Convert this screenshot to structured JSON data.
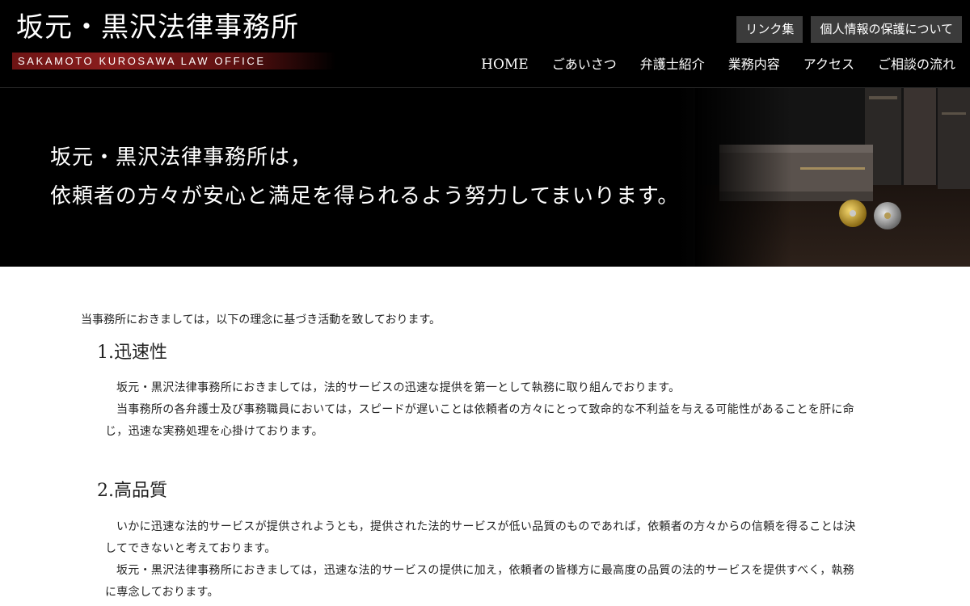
{
  "header": {
    "logo_title": "坂元・黒沢法律事務所",
    "logo_subtitle": "SAKAMOTO KUROSAWA LAW OFFICE",
    "utility_links": [
      "リンク集",
      "個人情報の保護について"
    ],
    "nav": [
      "HOME",
      "ごあいさつ",
      "弁護士紹介",
      "業務内容",
      "アクセス",
      "ご相談の流れ"
    ]
  },
  "hero": {
    "line1": "坂元・黒沢法律事務所は，",
    "line2": "依頼者の方々が安心と満足を得られるよう努力してまいります。"
  },
  "content": {
    "intro": "当事務所におきましては，以下の理念に基づき活動を致しております。",
    "sections": [
      {
        "title": "1.迅速性",
        "paragraphs": [
          "坂元・黒沢法律事務所におきましては，法的サービスの迅速な提供を第一として執務に取り組んでおります。",
          "当事務所の各弁護士及び事務職員においては，スピードが遅いことは依頼者の方々にとって致命的な不利益を与える可能性があることを肝に命じ，迅速な実務処理を心掛けております。"
        ]
      },
      {
        "title": "2.高品質",
        "paragraphs": [
          "いかに迅速な法的サービスが提供されようとも，提供された法的サービスが低い品質のものであれば，依頼者の方々からの信頼を得ることは決してできないと考えております。",
          "坂元・黒沢法律事務所におきましては，迅速な法的サービスの提供に加え，依頼者の皆様方に最高度の品質の法的サービスを提供すべく，執務に専念しております。"
        ]
      }
    ]
  },
  "colors": {
    "header_bg": "#000000",
    "logo_band": "#8a1d1d",
    "utility_button_bg": "#3b3b3b",
    "text": "#222222"
  },
  "icons": [
    "book-photo",
    "badge-gold",
    "badge-silver"
  ]
}
